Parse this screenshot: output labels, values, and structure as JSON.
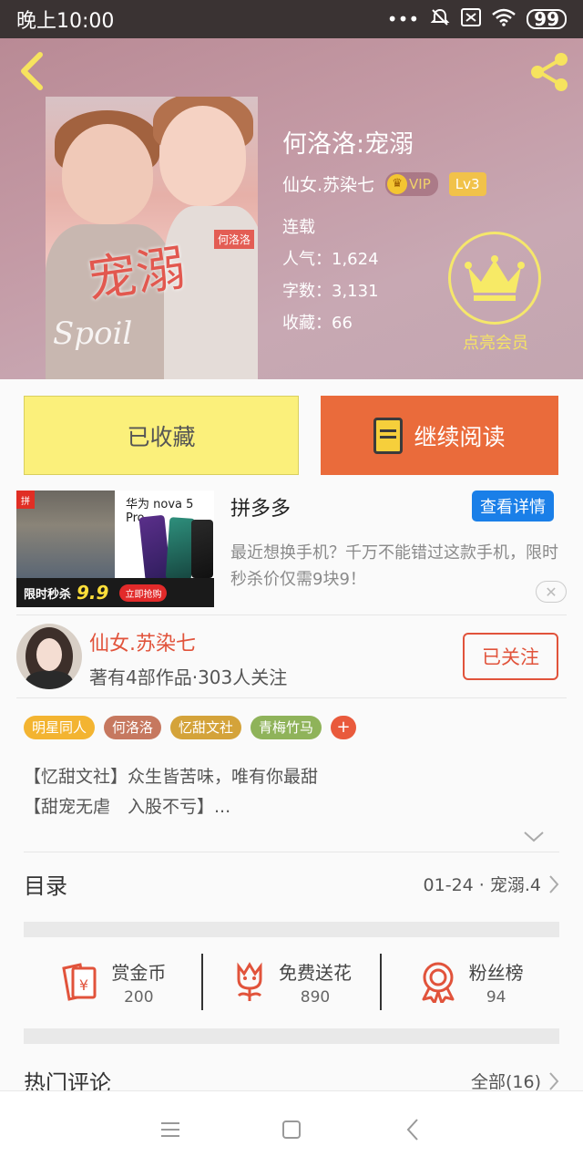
{
  "status_bar": {
    "time": "晚上10:00",
    "battery": "99"
  },
  "book": {
    "title": "何洛洛:宠溺",
    "author": "仙女.苏染七",
    "vip": "VIP",
    "level": "Lv3",
    "status": "连载",
    "popularity": "人气：1,624",
    "word_count": "字数：3,131",
    "favorites": "收藏：66",
    "member_label": "点亮会员",
    "cover_title": "宠溺",
    "cover_subtitle": "Spoil",
    "cover_tag": "何洛洛"
  },
  "actions": {
    "collected": "已收藏",
    "continue_reading": "继续阅读"
  },
  "ad": {
    "brand": "华为 nova 5 Pro",
    "sale_label": "限时秒杀",
    "price": "9.9",
    "buy_label": "立即抢购",
    "logo": "拼",
    "name": "拼多多",
    "detail_button": "查看详情",
    "description": "最近想换手机？千万不能错过这款手机，限时秒杀价仅需9块9！"
  },
  "author": {
    "name": "仙女.苏染七",
    "info": "著有4部作品·303人关注",
    "follow_button": "已关注"
  },
  "tags": [
    {
      "label": "明星同人",
      "color": "#f3b431"
    },
    {
      "label": "何洛洛",
      "color": "#c6785f"
    },
    {
      "label": "忆甜文社",
      "color": "#d4a33a"
    },
    {
      "label": "青梅竹马",
      "color": "#8fb35a"
    }
  ],
  "tag_more": "+",
  "synopsis": {
    "line1": "【忆甜文社】众生皆苦味，唯有你最甜",
    "line2": "【甜宠无虐　入股不亏】..."
  },
  "toc": {
    "label": "目录",
    "latest": "01-24 · 宠溺.4"
  },
  "gifts": [
    {
      "label": "赏金币",
      "value": "200",
      "icon": "red-envelope-icon"
    },
    {
      "label": "免费送花",
      "value": "890",
      "icon": "flower-icon"
    },
    {
      "label": "粉丝榜",
      "value": "94",
      "icon": "medal-icon"
    }
  ],
  "comments": {
    "label": "热门评论",
    "all": "全部(16)"
  },
  "colors": {
    "accent": "#ea6b3b",
    "author_red": "#e1533b",
    "collected_yellow": "#fbf07b",
    "ad_blue": "#1a7fe8"
  }
}
